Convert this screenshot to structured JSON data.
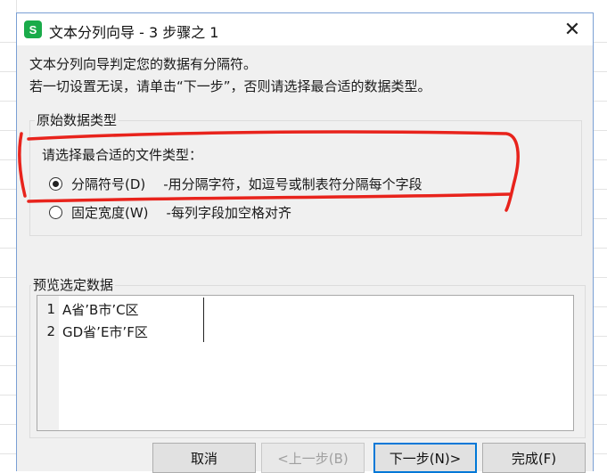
{
  "dialog": {
    "title": "文本分列向导 - 3 步骤之 1",
    "app_icon_letter": "S",
    "close_glyph": "✕",
    "description_line1": "文本分列向导判定您的数据有分隔符。",
    "description_line2": "若一切设置无误，请单击“下一步”，否则请选择最合适的数据类型。"
  },
  "original_data_type": {
    "legend": "原始数据类型",
    "prompt": "请选择最合适的文件类型：",
    "options": [
      {
        "label": "分隔符号(D)",
        "description": "-用分隔字符，如逗号或制表符分隔每个字段",
        "checked": true
      },
      {
        "label": "固定宽度(W)",
        "description": "-每列字段加空格对齐",
        "checked": false
      }
    ]
  },
  "preview": {
    "legend": "预览选定数据",
    "rows": [
      {
        "num": "1",
        "text": "A省’B市’C区"
      },
      {
        "num": "2",
        "text": "GD省’E市’F区"
      }
    ]
  },
  "buttons": {
    "cancel": "取消",
    "back": "<上一步(B)",
    "next": "下一步(N)>",
    "finish": "完成(F)"
  },
  "colors": {
    "annotation": "#e8231c",
    "app_icon": "#1aab4a",
    "focus_border": "#0078d7"
  }
}
